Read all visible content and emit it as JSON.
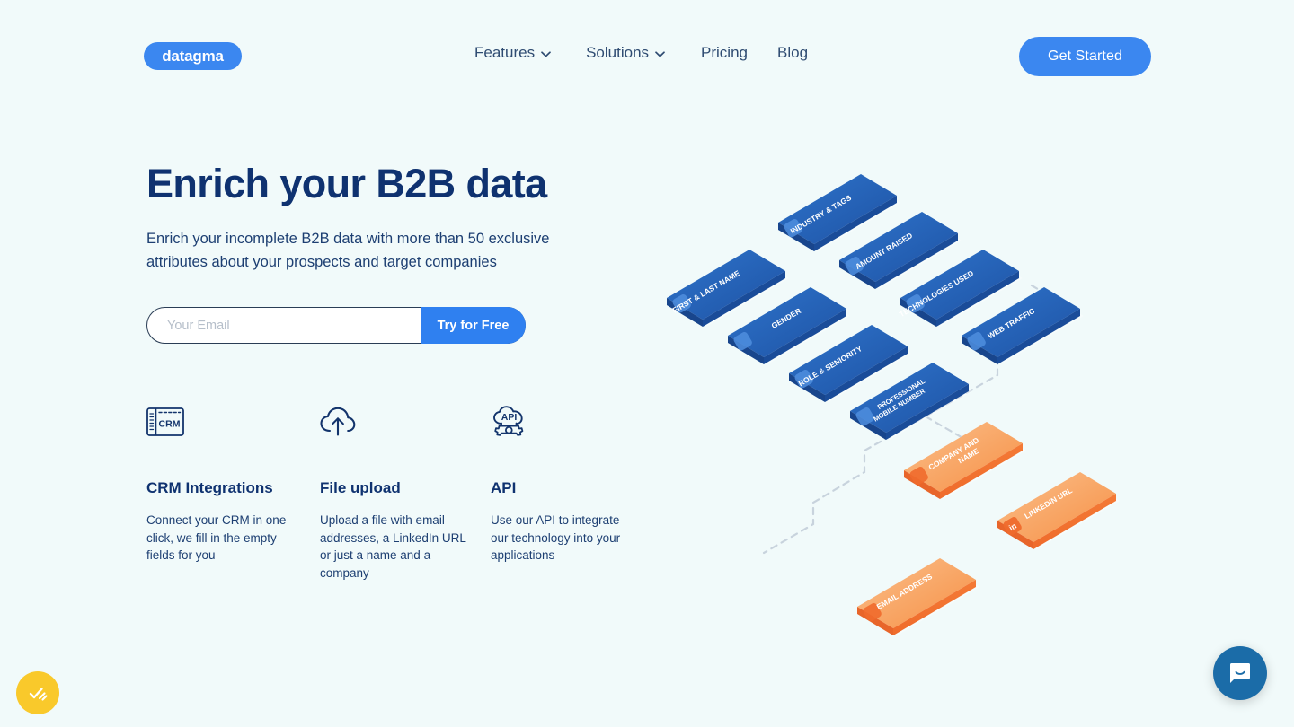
{
  "theme": {
    "page_bg": "#f1fafa",
    "brand_blue": "#3b87f0",
    "navy": "#0f3270",
    "orange": "#f4803f",
    "cookie_yellow": "#f9c92b",
    "chat_blue": "#1b6ca8"
  },
  "header": {
    "logo_text": "datagma",
    "nav": [
      {
        "label": "Features",
        "has_chevron": true,
        "icon": "chevron-down-icon"
      },
      {
        "label": "Solutions",
        "has_chevron": true,
        "icon": "chevron-down-icon"
      },
      {
        "label": "Pricing",
        "has_chevron": false,
        "icon": ""
      },
      {
        "label": "Blog",
        "has_chevron": false,
        "icon": ""
      }
    ],
    "cta_label": "Get Started"
  },
  "hero": {
    "title": "Enrich your B2B data",
    "subtitle": "Enrich your incomplete B2B data with more than 50 exclusive attributes about your prospects and target companies",
    "email_placeholder": "Your Email",
    "email_value": "",
    "submit_label": "Try for Free"
  },
  "features": [
    {
      "icon": "crm-card-icon",
      "icon_label": "CRM",
      "title": "CRM Integrations",
      "description": "Connect your CRM in one click, we fill in the empty fields for you"
    },
    {
      "icon": "cloud-upload-icon",
      "icon_label": "",
      "title": "File upload",
      "description": "Upload a file with email addresses, a LinkedIn URL or just a name and a company"
    },
    {
      "icon": "api-gear-icon",
      "icon_label": "API",
      "title": "API",
      "description": "Use our API to integrate our technology into your applications"
    }
  ],
  "illustration": {
    "alt": "Isometric data attribute blocks flowing into enriched outputs",
    "input_blocks": [
      {
        "label": "INDUSTRY & TAGS",
        "icon": "tag-icon",
        "color": "blue"
      },
      {
        "label": "AMOUNT RAISED",
        "icon": "money-icon",
        "color": "blue"
      },
      {
        "label": "TECHNOLOGIES USED",
        "icon": "stack-icon",
        "color": "blue"
      },
      {
        "label": "WEB TRAFFIC",
        "icon": "chart-icon",
        "color": "blue"
      },
      {
        "label": "FIRST & LAST NAME",
        "icon": "user-icon",
        "color": "blue"
      },
      {
        "label": "GENDER",
        "icon": "gender-icon",
        "color": "blue"
      },
      {
        "label": "ROLE & SENIORITY",
        "icon": "badge-icon",
        "color": "blue"
      },
      {
        "label": "PROFESSIONAL MOBILE NUMBER",
        "icon": "phone-icon",
        "color": "blue"
      }
    ],
    "output_blocks": [
      {
        "label": "COMPANY AND NAME",
        "icon": "building-icon",
        "color": "orange"
      },
      {
        "label": "LINKEDIN URL",
        "icon": "linkedin-icon",
        "color": "orange"
      },
      {
        "label": "EMAIL ADDRESS",
        "icon": "mail-icon",
        "color": "orange"
      }
    ]
  },
  "widgets": {
    "cookie_consent_icon": "cookie-hand-icon",
    "chat_launcher_icon": "chat-bubble-icon"
  }
}
